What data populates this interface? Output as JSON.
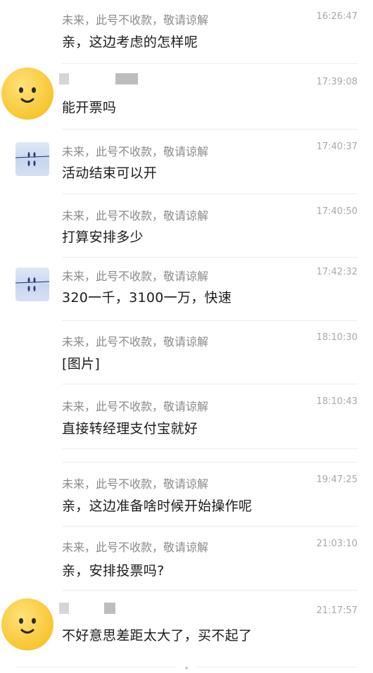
{
  "conversation": {
    "messages": [
      {
        "sender": "未来，此号不收款，敬请谅解",
        "time": "16:26:47",
        "text": "亲，这边考虑的怎样呢",
        "avatar": "none"
      },
      {
        "sender": "",
        "time": "17:39:08",
        "text": "能开票吗",
        "avatar": "smiley-emoji"
      },
      {
        "sender": "未来，此号不收款，敬请谅解",
        "time": "17:40:37",
        "text": "活动结束可以开",
        "avatar": "blue-photo"
      },
      {
        "sender": "未来，此号不收款，敬请谅解",
        "time": "17:40:50",
        "text": "打算安排多少",
        "avatar": "none"
      },
      {
        "sender": "未来，此号不收款，敬请谅解",
        "time": "17:42:32",
        "text": "320一千，3100一万，快速",
        "avatar": "blue-photo"
      },
      {
        "sender": "未来，此号不收款，敬请谅解",
        "time": "18:10:30",
        "text": "[图片]",
        "avatar": "none"
      },
      {
        "sender": "未来，此号不收款，敬请谅解",
        "time": "18:10:43",
        "text": "直接转经理支付宝就好",
        "avatar": "none"
      },
      {
        "sender": "未来，此号不收款，敬请谅解",
        "time": "19:47:25",
        "text": "亲，这边准备啥时候开始操作呢",
        "avatar": "none"
      },
      {
        "sender": "未来，此号不收款，敬请谅解",
        "time": "21:03:10",
        "text": "亲，安排投票吗?",
        "avatar": "none"
      },
      {
        "sender": "",
        "time": "21:17:57",
        "text": "不好意思差距太大了，买不起了",
        "avatar": "smiley-emoji"
      }
    ]
  },
  "colors": {
    "emoji_yellow": "#f7c631",
    "photo_blue": "#c9d6ef"
  }
}
